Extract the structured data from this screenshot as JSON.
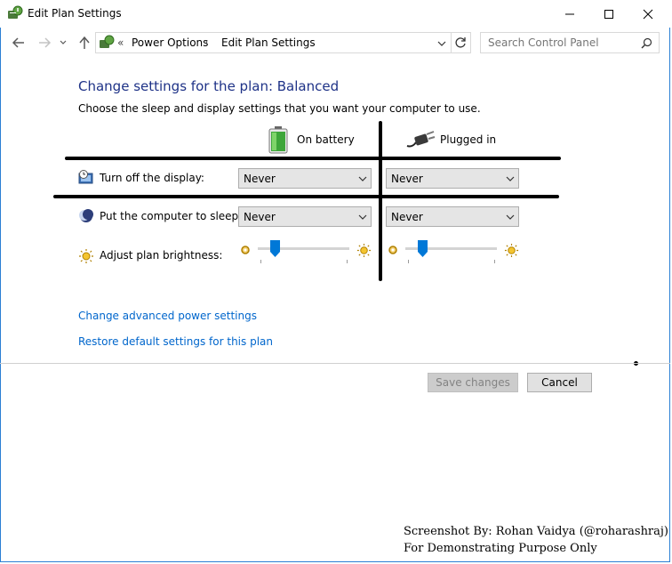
{
  "window": {
    "title": "Edit Plan Settings"
  },
  "address_bar": {
    "overflow": "«",
    "crumbs": [
      "Power Options",
      "Edit Plan Settings"
    ]
  },
  "search": {
    "placeholder": "Search Control Panel"
  },
  "main": {
    "heading": "Change settings for the plan: Balanced",
    "subtitle": "Choose the sleep and display settings that you want your computer to use.",
    "columns": {
      "battery": "On battery",
      "plugged": "Plugged in"
    },
    "rows": {
      "display": {
        "label": "Turn off the display:",
        "battery_value": "Never",
        "plugged_value": "Never"
      },
      "sleep": {
        "label": "Put the computer to sleep:",
        "battery_value": "Never",
        "plugged_value": "Never"
      },
      "brightness": {
        "label": "Adjust plan brightness:",
        "battery_level": 0.15,
        "plugged_level": 0.15
      }
    },
    "links": {
      "advanced": "Change advanced power settings",
      "restore": "Restore default settings for this plan"
    }
  },
  "buttons": {
    "save": "Save changes",
    "cancel": "Cancel"
  },
  "watermark": {
    "line1": "Screenshot By: Rohan Vaidya (@roharashraj)",
    "line2": "For Demonstrating Purpose Only"
  },
  "colors": {
    "heading": "#1e3287",
    "link": "#0066cc",
    "slider_thumb": "#0078d7",
    "window_border": "#2b7fd4"
  }
}
